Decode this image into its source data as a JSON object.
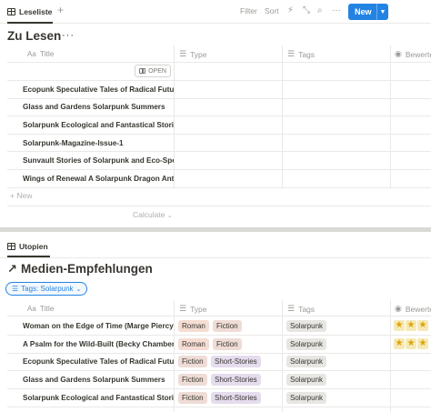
{
  "toolbar": {
    "tab_label": "Leseliste",
    "add_tab": "+",
    "filter": "Filter",
    "sort": "Sort",
    "new_label": "New",
    "icons": [
      "lightning-icon",
      "resize-icon",
      "search-icon",
      "more-icon"
    ]
  },
  "db1": {
    "title": "Zu Lesen",
    "menu": "···",
    "columns": {
      "title": "Title",
      "type": "Type",
      "tags": "Tags",
      "rating": "Bewerte"
    },
    "open_label": "OPEN",
    "rows": [
      "Ecopunk Speculative Tales of Radical Futures",
      "Glass and Gardens Solarpunk Summers",
      "Solarpunk Ecological and Fantastical Stories",
      "Solarpunk-Magazine-Issue-1",
      "Sunvault Stories of Solarpunk and Eco-Speculative Fiction",
      "Wings of Renewal A Solarpunk Dragon Anthology"
    ],
    "new_row": "New",
    "calculate": "Calculate"
  },
  "db2": {
    "tab_label": "Utopien",
    "title": "Medien-Empfehlungen",
    "filter_label": "Tags: Solarpunk",
    "columns": {
      "title": "Title",
      "type": "Type",
      "tags": "Tags",
      "rating": "Bewerte"
    },
    "rows": [
      {
        "title": "Woman on the Edge of Time (Marge Piercy)",
        "types": [
          "Roman",
          "Fiction"
        ],
        "tags": [
          "Solarpunk"
        ],
        "stars": 3
      },
      {
        "title": "A Psalm for the Wild-Built (Becky Chambers)",
        "types": [
          "Roman",
          "Fiction"
        ],
        "tags": [
          "Solarpunk"
        ],
        "stars": 3
      },
      {
        "title": "Ecopunk Speculative Tales of Radical Futures",
        "types": [
          "Fiction",
          "Short-Stories"
        ],
        "tags": [
          "Solarpunk"
        ],
        "stars": 0
      },
      {
        "title": "Glass and Gardens Solarpunk Summers",
        "types": [
          "Fiction",
          "Short-Stories"
        ],
        "tags": [
          "Solarpunk"
        ],
        "stars": 0
      },
      {
        "title": "Solarpunk Ecological and Fantastical Stories",
        "types": [
          "Fiction",
          "Short-Stories"
        ],
        "tags": [
          "Solarpunk"
        ],
        "stars": 0
      }
    ]
  },
  "colors": {
    "accent": "#2383e2",
    "text": "#37352f",
    "muted": "#9b9a97"
  }
}
